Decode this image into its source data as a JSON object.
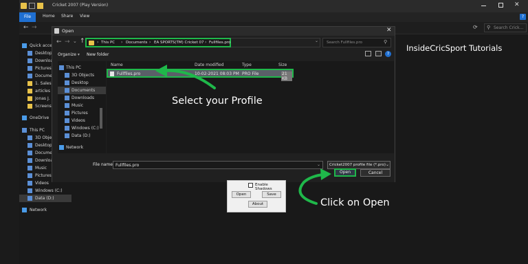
{
  "explorer": {
    "title": "Cricket 2007 (Play Version)",
    "ribbon_tabs": [
      "File",
      "Home",
      "Share",
      "View"
    ],
    "search_placeholder": "Search Crick...",
    "sidebar": [
      {
        "label": "Quick access",
        "icon": "star-icon"
      },
      {
        "label": "Desktop",
        "icon": "desktop-icon"
      },
      {
        "label": "Downloads",
        "icon": "download-icon"
      },
      {
        "label": "Pictures",
        "icon": "pictures-icon"
      },
      {
        "label": "Documents",
        "icon": "documents-icon"
      },
      {
        "label": "1. Sales",
        "icon": "folder-icon"
      },
      {
        "label": "articles",
        "icon": "folder-icon"
      },
      {
        "label": "Jonas J.",
        "icon": "folder-icon"
      },
      {
        "label": "Screens",
        "icon": "folder-icon"
      },
      {
        "label": "OneDrive",
        "icon": "cloud-icon"
      },
      {
        "label": "This PC",
        "icon": "pc-icon"
      },
      {
        "label": "3D Objects",
        "icon": "cube-icon"
      },
      {
        "label": "Desktop",
        "icon": "desktop-icon"
      },
      {
        "label": "Documents",
        "icon": "documents-icon"
      },
      {
        "label": "Downloads",
        "icon": "download-icon"
      },
      {
        "label": "Music",
        "icon": "music-icon"
      },
      {
        "label": "Pictures",
        "icon": "pictures-icon"
      },
      {
        "label": "Videos",
        "icon": "video-icon"
      },
      {
        "label": "Windows (C:)",
        "icon": "drive-icon"
      },
      {
        "label": "Data (D:)",
        "icon": "drive-icon"
      },
      {
        "label": "Network",
        "icon": "network-icon"
      }
    ]
  },
  "dialog": {
    "title": "Open",
    "breadcrumb": [
      "This PC",
      "Documents",
      "EA SPORTS(TM) Cricket 07",
      "Fullfiles.pro"
    ],
    "search_placeholder": "Search Fullfiles.pro",
    "organize_label": "Organize",
    "new_folder_label": "New folder",
    "columns": {
      "name": "Name",
      "date": "Date modified",
      "type": "Type",
      "size": "Size"
    },
    "files": [
      {
        "name": "Fullfiles.pro",
        "date": "10-02-2021 08:03 PM",
        "type": "PRO File",
        "size": "21 KB"
      }
    ],
    "tree": [
      {
        "label": "This PC",
        "icon": "pc-icon"
      },
      {
        "label": "3D Objects",
        "icon": "cube-icon"
      },
      {
        "label": "Desktop",
        "icon": "desktop-icon"
      },
      {
        "label": "Documents",
        "icon": "documents-icon"
      },
      {
        "label": "Downloads",
        "icon": "download-icon"
      },
      {
        "label": "Music",
        "icon": "music-icon"
      },
      {
        "label": "Pictures",
        "icon": "pictures-icon"
      },
      {
        "label": "Videos",
        "icon": "video-icon"
      },
      {
        "label": "Windows (C:)",
        "icon": "drive-icon"
      },
      {
        "label": "Data (D:)",
        "icon": "drive-icon"
      },
      {
        "label": "Network",
        "icon": "network-icon"
      }
    ],
    "file_name_label": "File name:",
    "file_name_value": "Fullfiles.pro",
    "file_type_value": "Cricket2007 profile file (*.pro)",
    "open_label": "Open",
    "cancel_label": "Cancel"
  },
  "settings": {
    "enable_shadows_label": "Enable Shadows",
    "open_label": "Open",
    "save_label": "Save",
    "about_label": "About"
  },
  "annotations": {
    "brand": "InsideCricSport Tutorials",
    "step1": "Select your Profile",
    "step2": "Click on Open"
  },
  "colors": {
    "highlight_green": "#1fb84a",
    "folder_yellow": "#e8c24a",
    "dark_bg": "#1b1b1b"
  }
}
